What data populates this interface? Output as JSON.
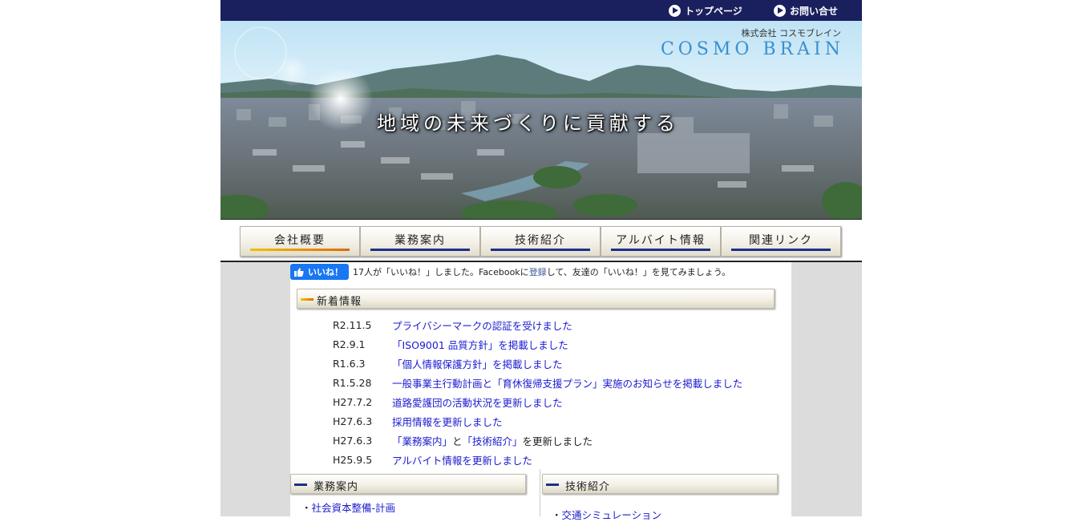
{
  "topnav": {
    "top_page": "トップページ",
    "contact": "お問い合せ"
  },
  "banner": {
    "company_sub": "株式会社 コスモブレイン",
    "company_name": "COSMO BRAIN",
    "tagline": "地域の未来づくりに貢献する"
  },
  "nav": {
    "items": [
      {
        "label": "会社概要"
      },
      {
        "label": "業務案内"
      },
      {
        "label": "技術紹介"
      },
      {
        "label": "アルバイト情報"
      },
      {
        "label": "関連リンク"
      }
    ]
  },
  "facebook": {
    "like_label": "いいね！",
    "prefix": "17人が「いいね！」しました。Facebookに",
    "register_link": "登録",
    "suffix": "して、友達の「いいね！」を見てみましょう。"
  },
  "news": {
    "title": "新着情報",
    "items": [
      {
        "date": "R2.11.5",
        "text": "プライバシーマークの認証を受けました"
      },
      {
        "date": "R2.9.1",
        "text": "「ISO9001 品質方針」を掲載しました"
      },
      {
        "date": "R1.6.3",
        "text": "「個人情報保護方針」を掲載しました"
      },
      {
        "date": "R1.5.28",
        "text": "一般事業主行動計画と「育休復帰支援プラン」実施のお知らせを掲載しました"
      },
      {
        "date": "H27.7.2",
        "text": "道路愛護団の活動状況を更新しました"
      },
      {
        "date": "H27.6.3",
        "text": "採用情報を更新しました"
      },
      {
        "date": "H27.6.3",
        "text_link1": "「業務案内」",
        "text_mid": "と",
        "text_link2": "「技術紹介」",
        "text_end": "を更新しました"
      },
      {
        "date": "H25.9.5",
        "text": "アルバイト情報を更新しました"
      }
    ]
  },
  "business": {
    "title": "業務案内",
    "first_item": "社会資本整備-計画"
  },
  "tech": {
    "title": "技術紹介",
    "first_item": "交通シミュレーション"
  },
  "colors": {
    "topbar": "#1a1f5e",
    "link": "#1a1ad0",
    "accent_orange": "#e06a00",
    "accent_blue": "#1c2f8c",
    "brand": "#3a8fd0"
  }
}
